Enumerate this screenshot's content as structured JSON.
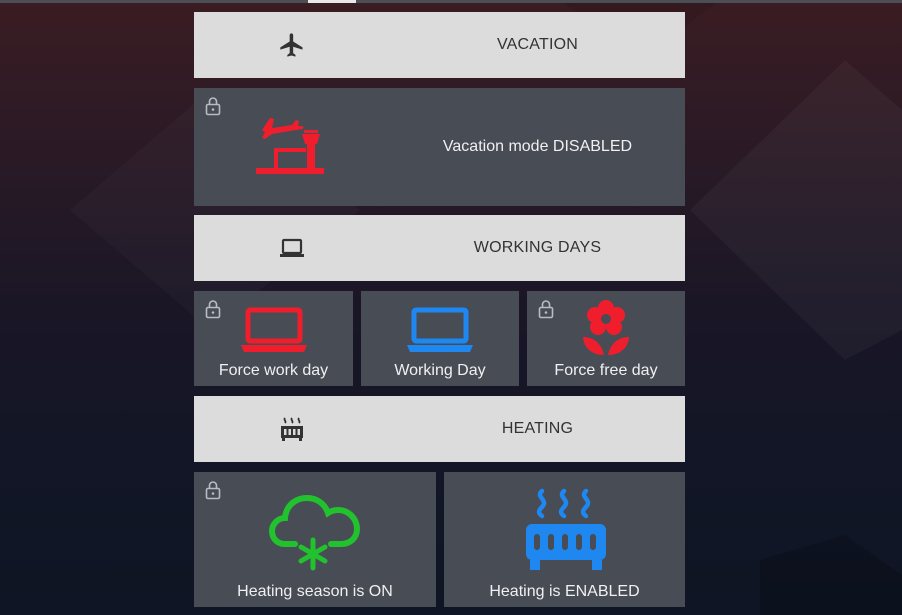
{
  "sections": {
    "vacation": {
      "header_label": "VACATION",
      "header_icon": "airplane-icon",
      "status_tile": {
        "label": "Vacation mode DISABLED",
        "icon": "airport-departure-icon",
        "icon_color": "#f01e2c",
        "locked": true
      }
    },
    "working_days": {
      "header_label": "WORKING DAYS",
      "header_icon": "laptop-icon",
      "tiles": [
        {
          "label": "Force work day",
          "icon": "laptop-icon",
          "icon_color": "#f01e2c",
          "locked": true
        },
        {
          "label": "Working Day",
          "icon": "laptop-icon",
          "icon_color": "#1e88f0",
          "locked": false
        },
        {
          "label": "Force free day",
          "icon": "flower-icon",
          "icon_color": "#f01e2c",
          "locked": true
        }
      ]
    },
    "heating": {
      "header_label": "HEATING",
      "header_icon": "radiator-icon",
      "tiles": [
        {
          "label": "Heating season is ON",
          "icon": "snow-cloud-icon",
          "icon_color": "#22c22e",
          "locked": true
        },
        {
          "label": "Heating is ENABLED",
          "icon": "radiator-icon",
          "icon_color": "#1e88f0",
          "locked": false
        }
      ]
    }
  },
  "colors": {
    "header_bg": "#dcdcdc",
    "tile_bg": "#474c55",
    "active_red": "#f01e2c",
    "active_blue": "#1e88f0",
    "active_green": "#22c22e"
  }
}
